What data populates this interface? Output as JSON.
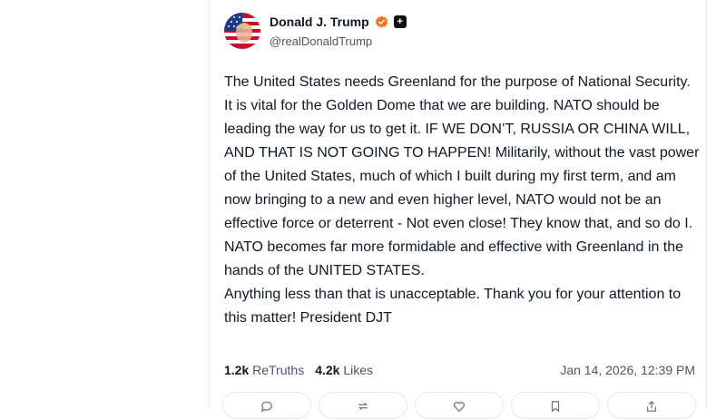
{
  "post": {
    "author": {
      "display_name": "Donald J. Trump",
      "handle": "@realDonaldTrump",
      "avatar_icon": "avatar-flag-icon",
      "verified_icon": "verified-badge-icon",
      "plus_badge": "+"
    },
    "text": "The United States needs Greenland for the purpose of National Security. It is vital for the Golden Dome that we are building. NATO should be leading the way for us to get it. IF WE DON’T, RUSSIA OR CHINA WILL, AND THAT IS NOT GOING TO HAPPEN! Militarily, without the vast power of the United States, much of which I built during my first term, and am now bringing to a new and even higher level, NATO would not be an effective force or deterrent - Not even close! They know that, and so do I. NATO becomes far more formidable and effective with Greenland in the hands of the UNITED STATES.\nAnything less than that is unacceptable. Thank you for your attention to this matter! President DJT",
    "stats": {
      "retruths_count": "1.2k",
      "retruths_label": "ReTruths",
      "likes_count": "4.2k",
      "likes_label": "Likes"
    },
    "timestamp": "Jan 14, 2026, 12:39 PM"
  },
  "actions": [
    "reply-icon",
    "retruth-icon",
    "like-icon",
    "bookmark-icon",
    "share-icon"
  ],
  "colors": {
    "verified": "#f97316",
    "text": "#111827",
    "muted": "#4b5563",
    "border": "#e5e7eb"
  }
}
